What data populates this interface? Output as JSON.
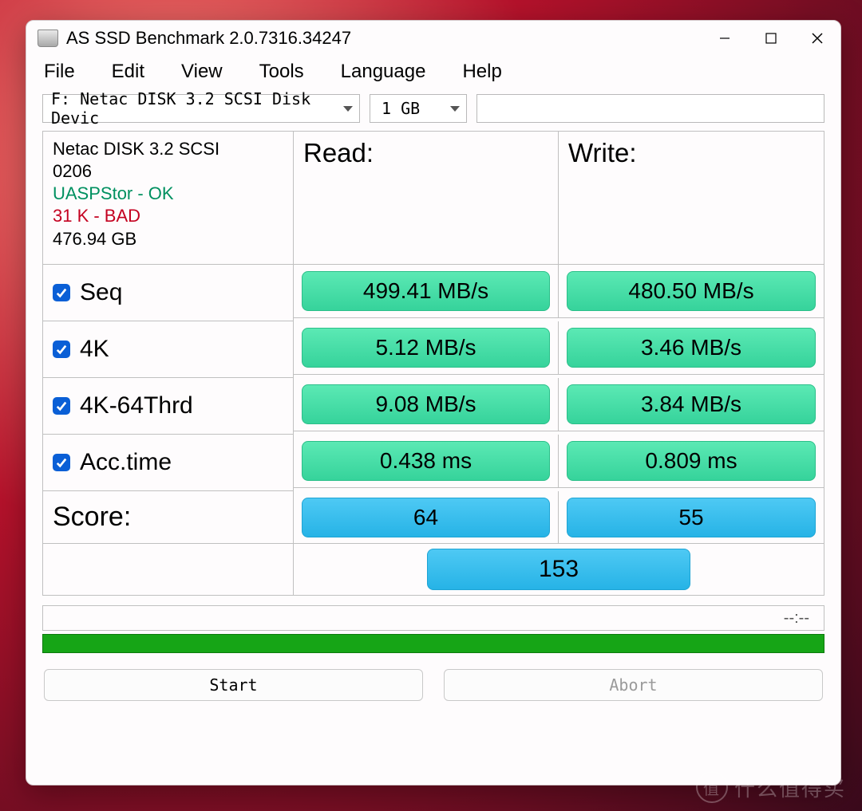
{
  "window": {
    "title": "AS SSD Benchmark 2.0.7316.34247"
  },
  "menu": {
    "file": "File",
    "edit": "Edit",
    "view": "View",
    "tools": "Tools",
    "language": "Language",
    "help": "Help"
  },
  "selectors": {
    "drive": "F: Netac DISK 3.2 SCSI Disk Devic",
    "size": "1 GB"
  },
  "device": {
    "name": "Netac DISK 3.2 SCSI",
    "firmware": "0206",
    "driver": "UASPStor - OK",
    "alignment": "31 K - BAD",
    "capacity": "476.94 GB"
  },
  "headers": {
    "read": "Read:",
    "write": "Write:"
  },
  "tests": {
    "seq": {
      "label": "Seq",
      "read": "499.41 MB/s",
      "write": "480.50 MB/s"
    },
    "k4": {
      "label": "4K",
      "read": "5.12 MB/s",
      "write": "3.46 MB/s"
    },
    "k4_64": {
      "label": "4K-64Thrd",
      "read": "9.08 MB/s",
      "write": "3.84 MB/s"
    },
    "acc": {
      "label": "Acc.time",
      "read": "0.438 ms",
      "write": "0.809 ms"
    }
  },
  "score": {
    "label": "Score:",
    "read": "64",
    "write": "55",
    "total": "153"
  },
  "progress": {
    "text": "--:--"
  },
  "buttons": {
    "start": "Start",
    "abort": "Abort"
  },
  "watermark": {
    "char": "值",
    "text": "什么值得买"
  }
}
